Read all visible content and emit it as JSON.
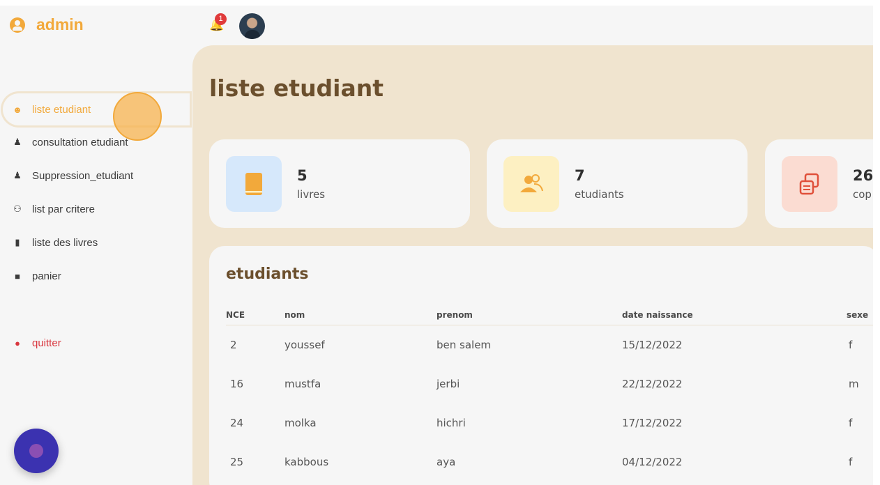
{
  "brand": {
    "title": "admin"
  },
  "topbar": {
    "notification_count": "1"
  },
  "sidebar": {
    "items": [
      {
        "label": "liste etudiant",
        "icon": "users-icon"
      },
      {
        "label": "consultation etudiant",
        "icon": "user-check-icon"
      },
      {
        "label": "Suppression_etudiant",
        "icon": "user-x-icon"
      },
      {
        "label": "list par critere",
        "icon": "people-icon"
      },
      {
        "label": "liste des livres",
        "icon": "books-icon"
      },
      {
        "label": "panier",
        "icon": "bag-icon"
      },
      {
        "label": "quitter",
        "icon": "stop-icon"
      }
    ]
  },
  "main": {
    "page_title": "liste etudiant",
    "cards": [
      {
        "number": "5",
        "label": "livres",
        "icon": "book-icon",
        "color": "#d6e8fb"
      },
      {
        "number": "7",
        "label": "etudiants",
        "icon": "users-icon",
        "color": "#fdf0c2"
      },
      {
        "number": "26",
        "label": "cop",
        "icon": "copies-icon",
        "color": "#fbdcd2"
      }
    ],
    "table": {
      "title": "etudiants",
      "headers": [
        "NCE",
        "nom",
        "prenom",
        "date naissance",
        "sexe"
      ],
      "rows": [
        [
          "2",
          "youssef",
          "ben salem",
          "15/12/2022",
          "f"
        ],
        [
          "16",
          "mustfa",
          "jerbi",
          "22/12/2022",
          "m"
        ],
        [
          "24",
          "molka",
          "hichri",
          "17/12/2022",
          "f"
        ],
        [
          "25",
          "kabbous",
          "aya",
          "04/12/2022",
          "f"
        ]
      ]
    }
  },
  "colors": {
    "accent": "#f2a93b",
    "main_bg": "#f0e4cf",
    "title": "#6b4f2d",
    "danger": "#d9363e"
  }
}
